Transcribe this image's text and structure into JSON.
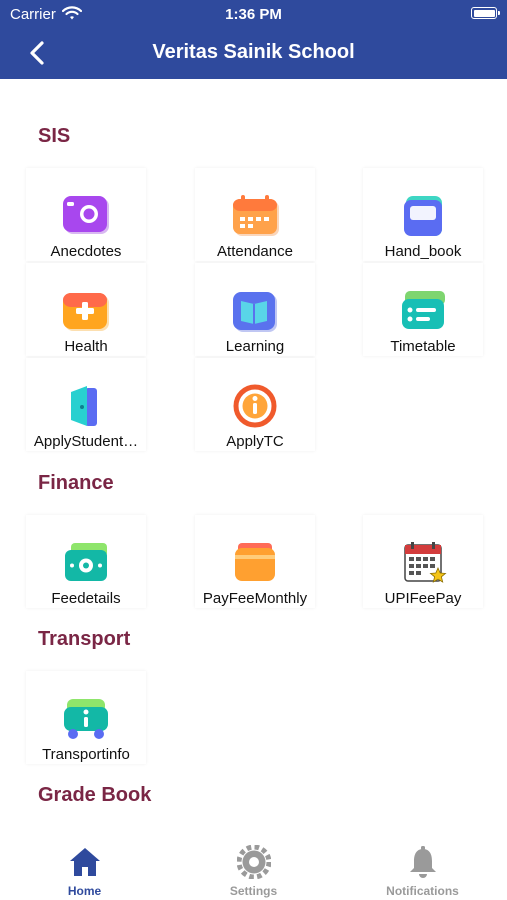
{
  "status_bar": {
    "carrier": "Carrier",
    "time": "1:36 PM"
  },
  "header": {
    "title": "Veritas Sainik School"
  },
  "sections": {
    "sis": {
      "title": "SIS",
      "items": [
        {
          "label": "Anecdotes",
          "icon": "camera-icon"
        },
        {
          "label": "Attendance",
          "icon": "calendar-icon"
        },
        {
          "label": "Hand_book",
          "icon": "handbook-icon"
        },
        {
          "label": "Health",
          "icon": "health-kit-icon"
        },
        {
          "label": "Learning",
          "icon": "open-book-icon"
        },
        {
          "label": "Timetable",
          "icon": "timetable-icon"
        },
        {
          "label": "ApplyStudent…",
          "icon": "door-icon"
        },
        {
          "label": "ApplyTC",
          "icon": "info-icon"
        }
      ]
    },
    "finance": {
      "title": "Finance",
      "items": [
        {
          "label": "Feedetails",
          "icon": "cash-icon"
        },
        {
          "label": "PayFeeMonthly",
          "icon": "card-icon"
        },
        {
          "label": "UPIFeePay",
          "icon": "calendar-star-icon"
        }
      ]
    },
    "transport": {
      "title": "Transport",
      "items": [
        {
          "label": "Transportinfo",
          "icon": "bus-info-icon"
        }
      ]
    },
    "gradebook": {
      "title": "Grade Book"
    }
  },
  "tabs": [
    {
      "label": "Home",
      "icon": "home-icon",
      "active": true
    },
    {
      "label": "Settings",
      "icon": "gear-icon",
      "active": false
    },
    {
      "label": "Notifications",
      "icon": "bell-icon",
      "active": false
    }
  ],
  "colors": {
    "primary": "#2f4a9d",
    "section_title": "#7a2645",
    "inactive": "#9a9a9a"
  }
}
